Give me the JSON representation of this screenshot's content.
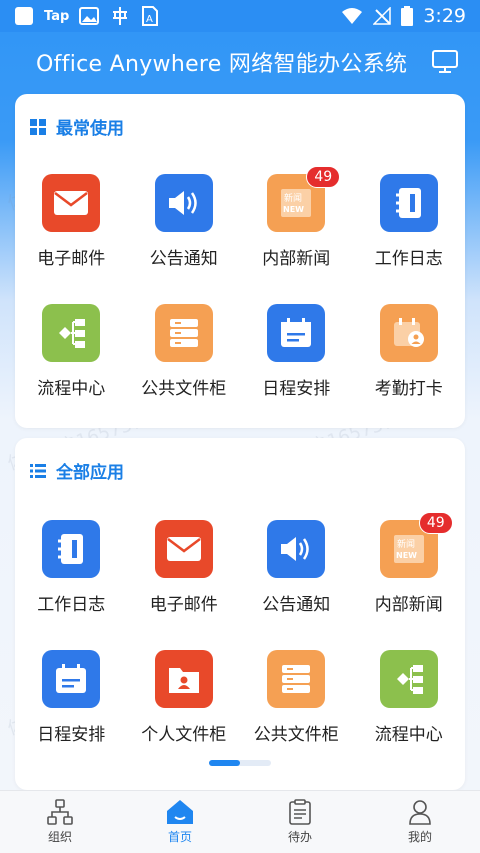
{
  "status_bar": {
    "tap_label": "Tap",
    "time": "3:29"
  },
  "header": {
    "title": "Office Anywhere  网络智能办公系统",
    "monitor_icon": "monitor-icon"
  },
  "watermark_text": "体验用户16573732",
  "frequent": {
    "title": "最常使用",
    "icon": "grid-icon",
    "apps": [
      {
        "label": "电子邮件",
        "icon": "mail-icon",
        "color": "#e8492a"
      },
      {
        "label": "公告通知",
        "icon": "speaker-icon",
        "color": "#2f79e9"
      },
      {
        "label": "内部新闻",
        "icon": "news-icon",
        "color": "#f5a053",
        "badge": "49"
      },
      {
        "label": "工作日志",
        "icon": "notebook-icon",
        "color": "#2f79e9"
      },
      {
        "label": "流程中心",
        "icon": "flow-icon",
        "color": "#8cc04d"
      },
      {
        "label": "公共文件柜",
        "icon": "cabinet-icon",
        "color": "#f5a053"
      },
      {
        "label": "日程安排",
        "icon": "calendar-icon",
        "color": "#2f79e9"
      },
      {
        "label": "考勤打卡",
        "icon": "attendance-icon",
        "color": "#f5a053"
      }
    ]
  },
  "all_apps": {
    "title": "全部应用",
    "icon": "list-icon",
    "apps": [
      {
        "label": "工作日志",
        "icon": "notebook-icon",
        "color": "#2f79e9"
      },
      {
        "label": "电子邮件",
        "icon": "mail-icon",
        "color": "#e8492a"
      },
      {
        "label": "公告通知",
        "icon": "speaker-icon",
        "color": "#2f79e9"
      },
      {
        "label": "内部新闻",
        "icon": "news-icon",
        "color": "#f5a053",
        "badge": "49"
      },
      {
        "label": "日程安排",
        "icon": "calendar-icon",
        "color": "#2f79e9"
      },
      {
        "label": "个人文件柜",
        "icon": "personal-folder-icon",
        "color": "#e8492a"
      },
      {
        "label": "公共文件柜",
        "icon": "cabinet-icon",
        "color": "#f5a053"
      },
      {
        "label": "流程中心",
        "icon": "flow-icon",
        "color": "#8cc04d"
      }
    ],
    "pager": {
      "current_page": 1,
      "total_pages": 2
    }
  },
  "tab_bar": {
    "active_color": "#1f86f0",
    "tabs": [
      {
        "label": "组织",
        "icon": "org-chart-icon",
        "active": false
      },
      {
        "label": "首页",
        "icon": "home-icon",
        "active": true
      },
      {
        "label": "待办",
        "icon": "clipboard-icon",
        "active": false
      },
      {
        "label": "我的",
        "icon": "user-icon",
        "active": false
      }
    ]
  }
}
